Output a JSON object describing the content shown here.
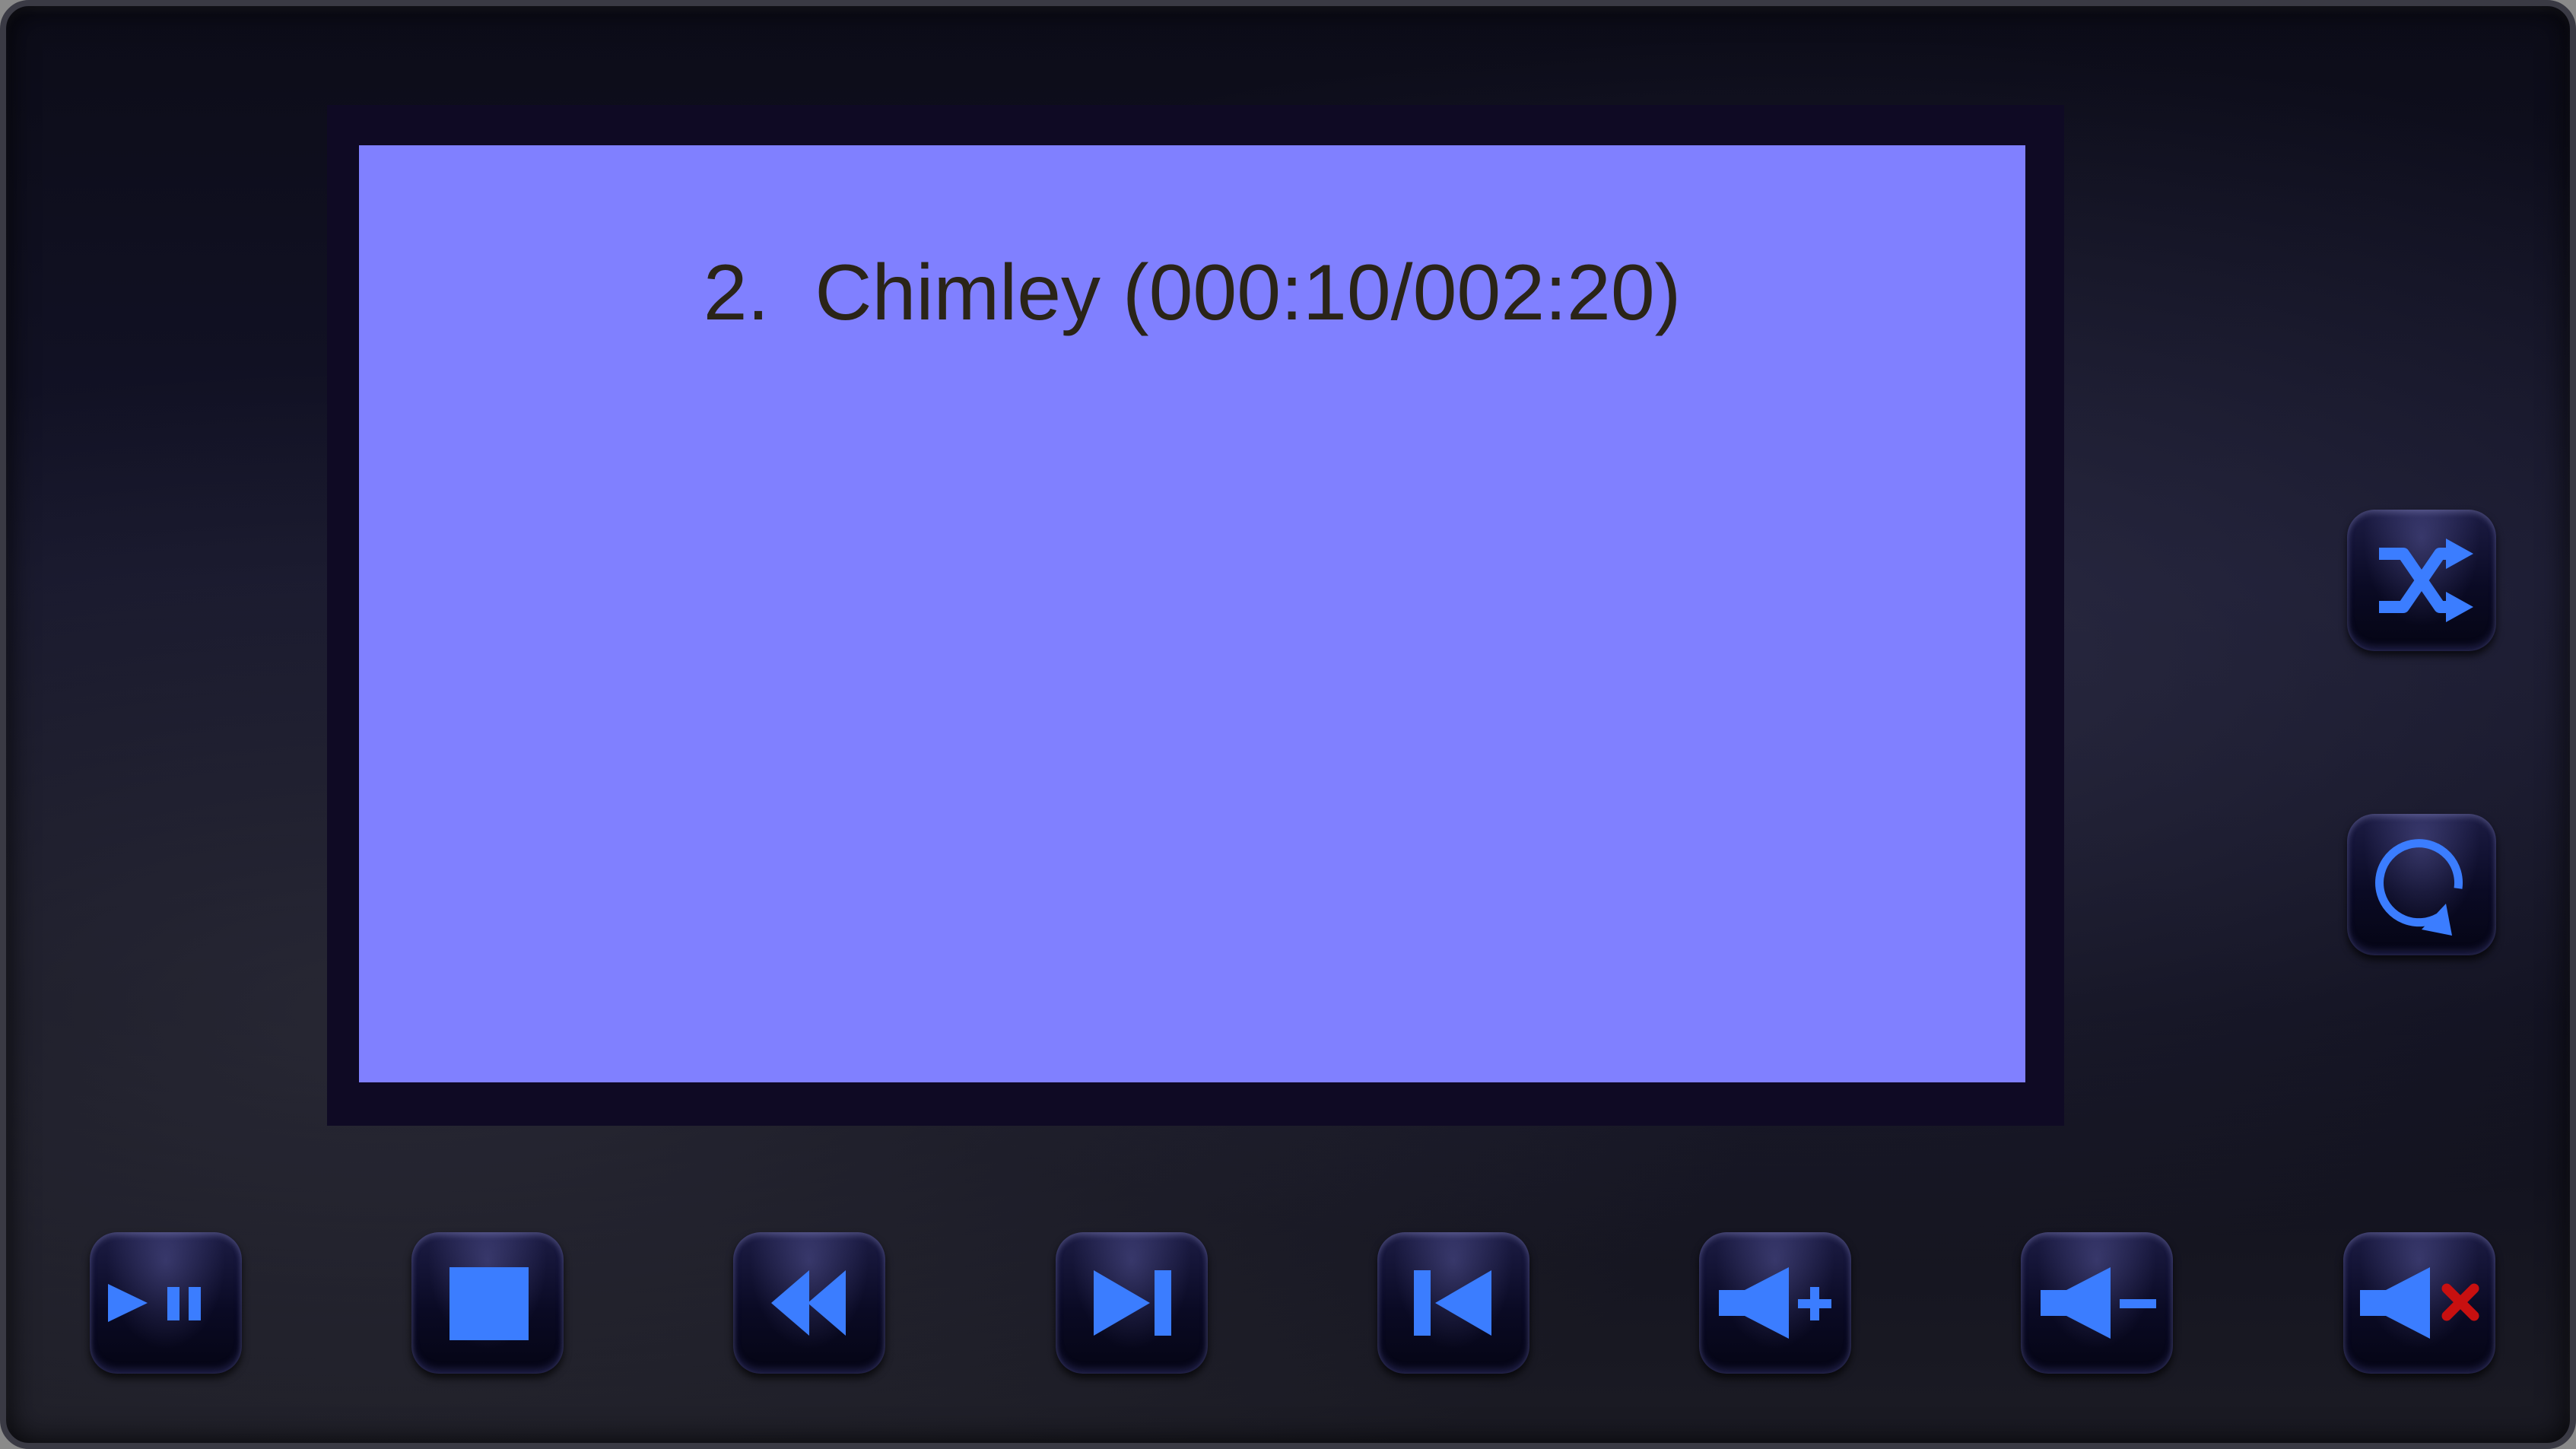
{
  "player": {
    "track_number": "2.",
    "track_title_time": "Chimley (000:10/002:20)"
  },
  "controls": {
    "bottom": [
      {
        "name": "play-pause-button",
        "icon": "play-pause-icon"
      },
      {
        "name": "stop-button",
        "icon": "stop-icon"
      },
      {
        "name": "rewind-button",
        "icon": "rewind-icon"
      },
      {
        "name": "next-track-button",
        "icon": "skip-next-icon"
      },
      {
        "name": "previous-track-button",
        "icon": "skip-previous-icon"
      },
      {
        "name": "volume-up-button",
        "icon": "volume-up-icon"
      },
      {
        "name": "volume-down-button",
        "icon": "volume-down-icon"
      },
      {
        "name": "mute-button",
        "icon": "mute-icon"
      }
    ],
    "side": [
      {
        "name": "shuffle-button",
        "icon": "shuffle-icon"
      },
      {
        "name": "repeat-button",
        "icon": "repeat-icon"
      }
    ]
  },
  "colors": {
    "screen": "#8080ff",
    "icon": "#3b7dff",
    "mute_x": "#c81010",
    "text": "#2a2418"
  }
}
